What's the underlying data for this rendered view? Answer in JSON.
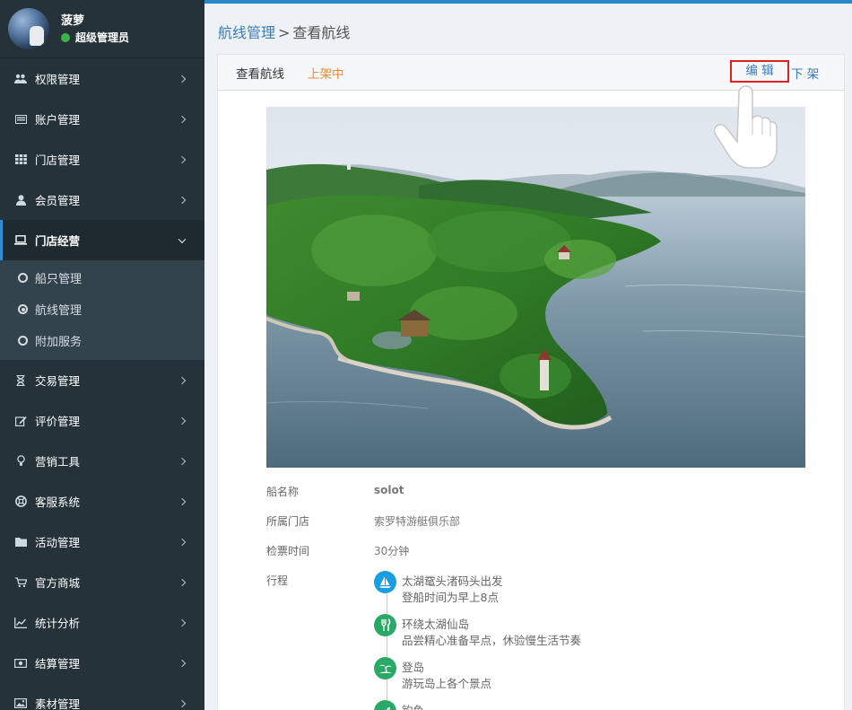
{
  "user": {
    "name": "菠萝",
    "role": "超级管理员"
  },
  "nav": [
    {
      "label": "权限管理",
      "icon": "users-icon"
    },
    {
      "label": "账户管理",
      "icon": "list-card-icon"
    },
    {
      "label": "门店管理",
      "icon": "grid-icon"
    },
    {
      "label": "会员管理",
      "icon": "user-icon"
    },
    {
      "label": "门店经营",
      "icon": "laptop-icon",
      "expanded": true
    },
    {
      "label": "交易管理",
      "icon": "hourglass-icon"
    },
    {
      "label": "评价管理",
      "icon": "edit-icon"
    },
    {
      "label": "营销工具",
      "icon": "lightbulb-icon"
    },
    {
      "label": "客服系统",
      "icon": "lifebuoy-icon"
    },
    {
      "label": "活动管理",
      "icon": "folder-icon"
    },
    {
      "label": "官方商城",
      "icon": "cart-icon"
    },
    {
      "label": "统计分析",
      "icon": "line-chart-icon"
    },
    {
      "label": "结算管理",
      "icon": "money-icon"
    },
    {
      "label": "素材管理",
      "icon": "image-icon"
    }
  ],
  "submenu": [
    {
      "label": "船只管理",
      "active": false
    },
    {
      "label": "航线管理",
      "active": true
    },
    {
      "label": "附加服务",
      "active": false
    }
  ],
  "breadcrumb": {
    "parent": "航线管理",
    "separator": ">",
    "current": "查看航线"
  },
  "card": {
    "title": "查看航线",
    "status": "上架中",
    "edit_label": "编 辑",
    "offshelf_label": "下 架"
  },
  "details": [
    {
      "label": "船名称",
      "value": "solot"
    },
    {
      "label": "所属门店",
      "value": "索罗特游艇俱乐部"
    },
    {
      "label": "检票时间",
      "value": "30分钟"
    },
    {
      "label": "行程",
      "value": ""
    }
  ],
  "itinerary": [
    {
      "title": "太湖鼋头渚码头出发",
      "sub": "登船时间为早上8点",
      "icon": "sailboat-icon",
      "color": "#1a9ee2"
    },
    {
      "title": "环绕太湖仙岛",
      "sub": "品尝精心准备早点，休验慢生活节奏",
      "icon": "cutlery-icon",
      "color": "#2aa866"
    },
    {
      "title": "登岛",
      "sub": "游玩岛上各个景点",
      "icon": "palm-island-icon",
      "color": "#2aa866"
    },
    {
      "title": "钓鱼",
      "sub": "",
      "icon": "fishing-icon",
      "color": "#2aa866"
    }
  ],
  "colors": {
    "accent": "#2a86c8",
    "status": "#ef8a3a",
    "link": "#3a7cc0",
    "sidebar": "#253239"
  }
}
